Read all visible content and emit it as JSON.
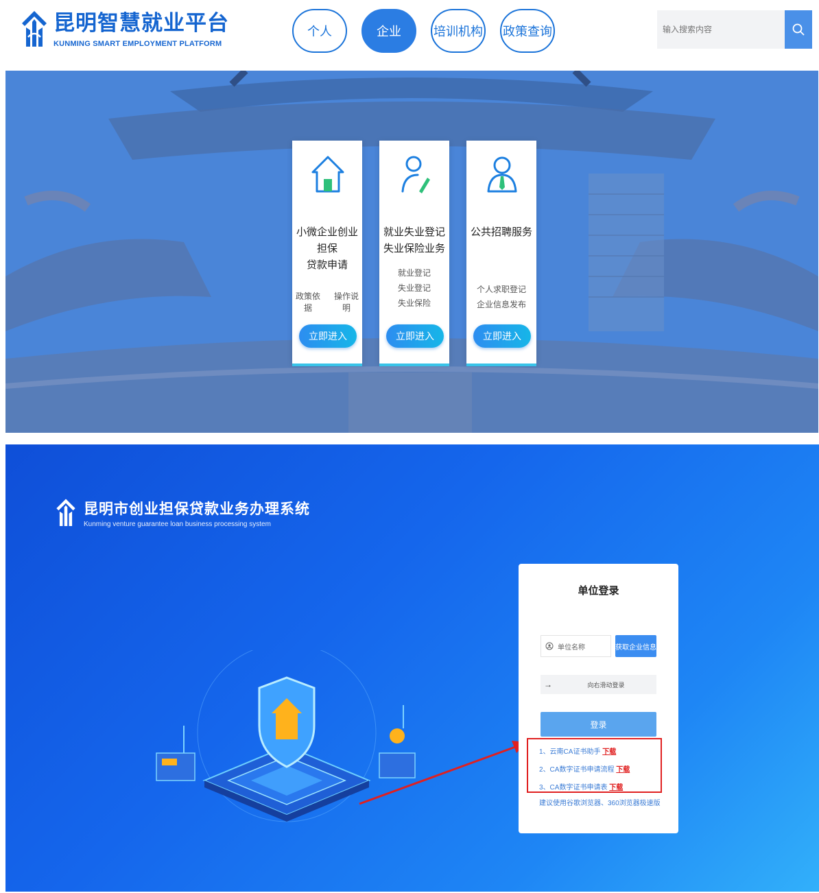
{
  "platform": {
    "title": "昆明智慧就业平台",
    "subtitle": "KUNMING SMART EMPLOYMENT PLATFORM",
    "logo_icon": "house-arrows-logo-icon",
    "brand_color": "#1565d0"
  },
  "nav": {
    "items": [
      {
        "label": "个人",
        "active": false
      },
      {
        "label": "企业",
        "active": true
      },
      {
        "label": "培训机构",
        "active": false
      },
      {
        "label": "政策查询",
        "active": false
      }
    ]
  },
  "search": {
    "placeholder": "输入搜索内容",
    "icon": "search-icon"
  },
  "cards": [
    {
      "icon": "house-icon",
      "title_lines": [
        "小微企业创业担保",
        "贷款申请"
      ],
      "links": [
        "政策依据",
        "操作说明"
      ],
      "button": "立即进入"
    },
    {
      "icon": "user-pen-icon",
      "title_lines": [
        "就业失业登记",
        "失业保险业务"
      ],
      "items": [
        "就业登记",
        "失业登记",
        "失业保险"
      ],
      "button": "立即进入"
    },
    {
      "icon": "person-tie-icon",
      "title_lines": [
        "公共招聘服务"
      ],
      "items": [
        "个人求职登记",
        "企业信息发布"
      ],
      "button": "立即进入"
    }
  ],
  "system": {
    "title": "昆明市创业担保贷款业务办理系统",
    "subtitle": "Kunming venture guarantee loan business processing system"
  },
  "login": {
    "title": "单位登录",
    "unit_placeholder": "单位名称",
    "get_info_button": "获取企业信息",
    "slider_text": "向右滑动登录",
    "login_button": "登录",
    "downloads": [
      {
        "text": "1、云南CA证书助手",
        "link": "下载"
      },
      {
        "text": "2、CA数字证书申请流程",
        "link": "下载"
      },
      {
        "text": "3、CA数字证书申请表",
        "link": "下载"
      }
    ],
    "browser_tip": "建议使用谷歌浏览器、360浏览器极速版",
    "highlight_color": "#e02020"
  }
}
